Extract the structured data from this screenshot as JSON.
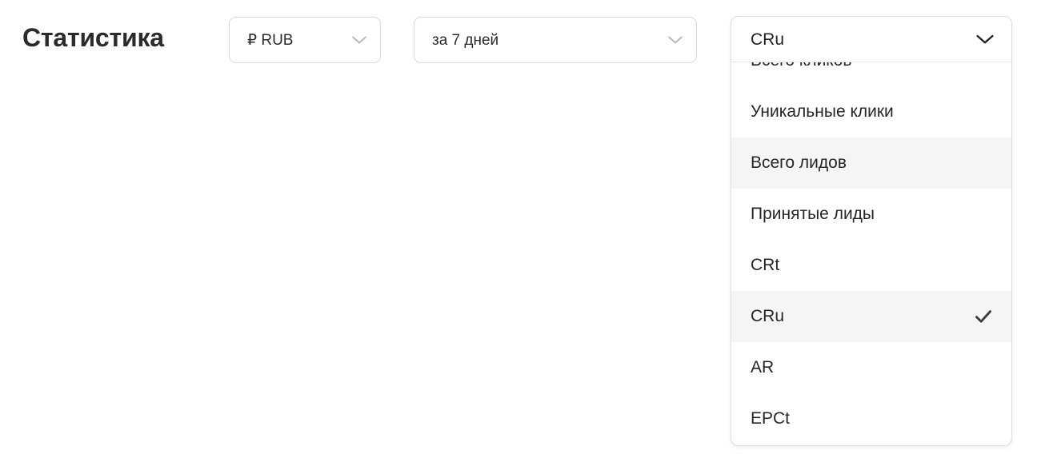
{
  "page": {
    "title": "Статистика",
    "background": "#ffffff"
  },
  "toolbar": {
    "currency_select": {
      "value": "₽ RUB",
      "icon": "chevron-down-icon"
    },
    "period_select": {
      "value": "за 7 дней",
      "icon": "chevron-down-icon"
    }
  },
  "metric_dropdown": {
    "value": "CRu",
    "expanded": true,
    "icon": "chevron-down-icon",
    "check_icon": "check-icon",
    "options": [
      {
        "label": "Всего кликов",
        "selected": false,
        "hovered": false
      },
      {
        "label": "Уникальные клики",
        "selected": false,
        "hovered": false
      },
      {
        "label": "Всего лидов",
        "selected": false,
        "hovered": true
      },
      {
        "label": "Принятые лиды",
        "selected": false,
        "hovered": false
      },
      {
        "label": "CRt",
        "selected": false,
        "hovered": false
      },
      {
        "label": "CRu",
        "selected": true,
        "hovered": false
      },
      {
        "label": "AR",
        "selected": false,
        "hovered": false
      },
      {
        "label": "EPCt",
        "selected": false,
        "hovered": false
      }
    ]
  },
  "colors": {
    "text_primary": "#2b2b2b",
    "text_option": "#262626",
    "border": "#d8dadd",
    "panel_border": "#dcdee1",
    "highlight": "#f5f5f6",
    "chevron_muted": "#b8bcc2",
    "chevron_strong": "#1f1f1f",
    "check": "#3d3d3d"
  }
}
